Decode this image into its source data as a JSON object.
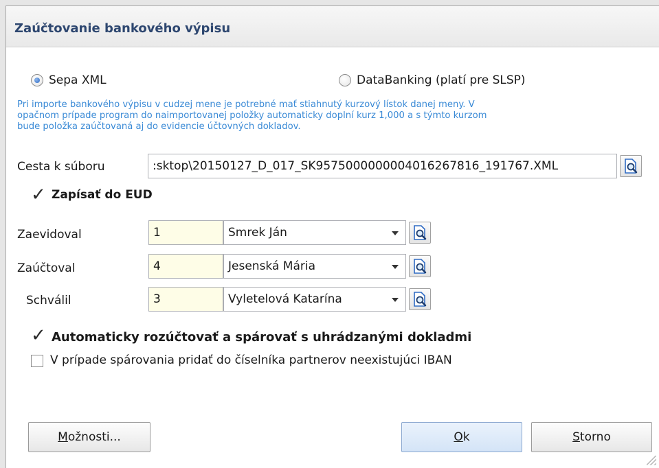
{
  "dialog": {
    "title": "Zaúčtovanie bankového výpisu"
  },
  "format": {
    "options": [
      {
        "label": "Sepa XML",
        "selected": true
      },
      {
        "label": "DataBanking (platí pre SLSP)",
        "selected": false
      }
    ],
    "info_lines": [
      "Pri importe bankového výpisu v cudzej mene je potrebné mať stiahnutý kurzový lístok danej meny. V",
      "opačnom prípade program do naimportovanej položky automaticky doplní kurz 1,000 a s týmto kurzom",
      "bude položka zaúčtovaná aj do evidencie účtovných dokladov."
    ]
  },
  "file": {
    "label": "Cesta k súboru",
    "value": ":sktop\\20150127_D_017_SK9575000000004016267816_191767.XML"
  },
  "eud": {
    "label": "Zapísať do EUD",
    "checked": true
  },
  "people": [
    {
      "label": "Zaevidoval",
      "code": "1",
      "name": "Smrek Ján"
    },
    {
      "label": "Zaúčtoval",
      "code": "4",
      "name": "Jesenská Mária"
    },
    {
      "label": "Schválil",
      "code": "3",
      "name": "Vyletelová Katarína"
    }
  ],
  "options": {
    "auto_pair": {
      "label": "Automaticky rozúčtovať a spárovať s uhrádzanými dokladmi",
      "checked": true
    },
    "add_iban": {
      "label": "V prípade spárovania pridať do číselníka partnerov neexistujúci IBAN",
      "checked": false
    }
  },
  "buttons": {
    "options": {
      "accel": "M",
      "rest": "ožnosti..."
    },
    "ok": {
      "accel": "O",
      "rest": "k"
    },
    "cancel": {
      "accel": "S",
      "rest": "torno"
    }
  },
  "colors": {
    "title": "#2e4770",
    "info_text": "#3a8ad6",
    "code_field_bg": "#fefde7"
  },
  "icons": {
    "lookup": "document-magnifier-icon",
    "radio_selected": "radio-selected-icon",
    "checkmark": "checkmark-icon",
    "dropdown": "chevron-down-icon"
  }
}
